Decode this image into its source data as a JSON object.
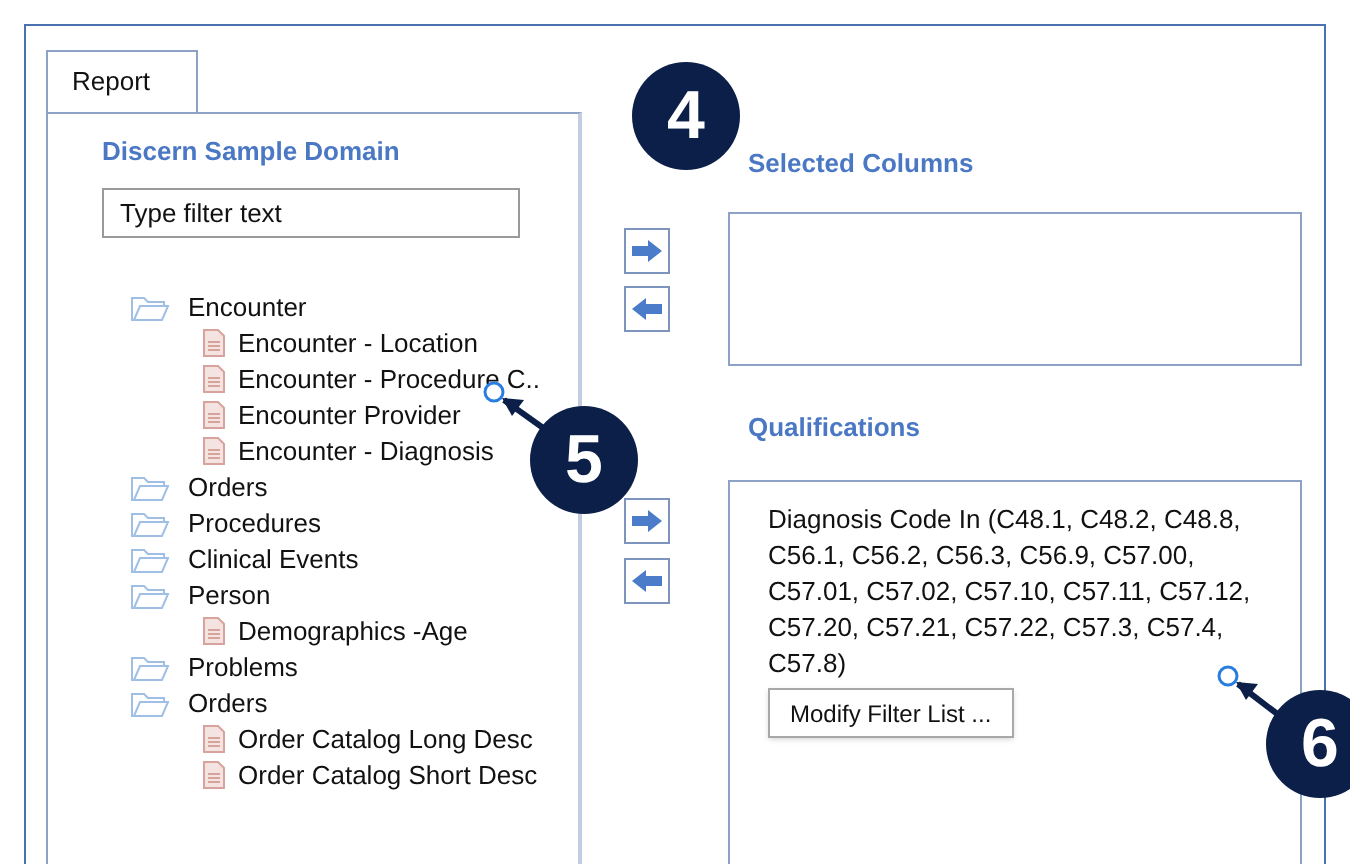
{
  "tabs": [
    {
      "label": "Report",
      "selected": true
    }
  ],
  "domain": {
    "title": "Discern Sample Domain",
    "filter": {
      "placeholder": "Type filter text"
    },
    "tree": [
      {
        "label": "Encounter",
        "kind": "folder",
        "children": [
          {
            "label": "Encounter - Location",
            "kind": "field"
          },
          {
            "label": "Encounter - Procedure C..",
            "kind": "field"
          },
          {
            "label": "Encounter Provider",
            "kind": "field"
          },
          {
            "label": "Encounter - Diagnosis",
            "kind": "field"
          }
        ]
      },
      {
        "label": "Orders",
        "kind": "folder"
      },
      {
        "label": "Procedures",
        "kind": "folder"
      },
      {
        "label": "Clinical Events",
        "kind": "folder"
      },
      {
        "label": "Person",
        "kind": "folder",
        "children": [
          {
            "label": "Demographics -Age",
            "kind": "field"
          }
        ]
      },
      {
        "label": "Problems",
        "kind": "folder"
      },
      {
        "label": "Orders",
        "kind": "folder",
        "children": [
          {
            "label": "Order Catalog Long Desc",
            "kind": "field"
          },
          {
            "label": "Order Catalog Short Desc",
            "kind": "field"
          }
        ]
      }
    ]
  },
  "selected_columns": {
    "title": "Selected Columns"
  },
  "qualifications": {
    "title": "Qualifications",
    "text": "Diagnosis Code In (C48.1, C48.2, C48.8, C56.1, C56.2, C56.3, C56.9, C57.00, C57.01, C57.02, C57.10, C57.11, C57.12, C57.20, C57.21, C57.22, C57.3, C57.4, C57.8)",
    "button": "Modify Filter List ..."
  },
  "callouts": [
    "4",
    "5",
    "6"
  ]
}
